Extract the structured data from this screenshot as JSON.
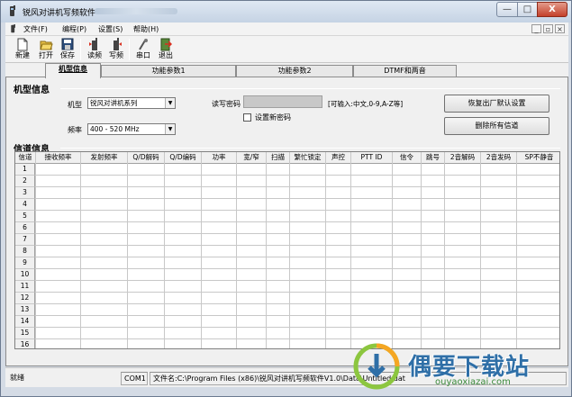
{
  "window": {
    "title": "锐风对讲机写频软件",
    "controls": {
      "minimize": "—",
      "maximize": "□",
      "close": "X"
    }
  },
  "menu": [
    {
      "label": "文件(F)"
    },
    {
      "label": "编程(P)"
    },
    {
      "label": "设置(S)"
    },
    {
      "label": "帮助(H)"
    }
  ],
  "mdi_controls": {
    "minimize": "_",
    "restore": "▫",
    "close": "×"
  },
  "toolbar": {
    "new": "新建",
    "open": "打开",
    "save": "保存",
    "read": "读频",
    "write": "写频",
    "port": "串口",
    "exit": "退出"
  },
  "tabs": [
    {
      "label": "机型信息",
      "active": true
    },
    {
      "label": "功能参数1",
      "active": false
    },
    {
      "label": "功能参数2",
      "active": false
    },
    {
      "label": "DTMF和两音",
      "active": false
    }
  ],
  "model_info": {
    "group_title": "机型信息",
    "model_label": "机型",
    "model_value": "锐风对讲机系列",
    "freq_label": "频率",
    "freq_value": "400 - 520 MHz",
    "pwd_label": "读写密码",
    "pwd_hint": "[可输入:中文,0-9,A-Z等]",
    "new_pwd_label": "设置新密码",
    "restore_button": "恢复出厂默认设置",
    "delete_button": "删除所有信道"
  },
  "channel_info": {
    "group_title": "信道信息",
    "columns": [
      "信道",
      "接收频率",
      "发射频率",
      "Q/D解码",
      "Q/D编码",
      "功率",
      "宽/窄",
      "扫描",
      "繁忙锁定",
      "声控",
      "PTT ID",
      "信令",
      "跳号",
      "2音解码",
      "2音发码",
      "SP不静音"
    ],
    "rows": [
      "1",
      "2",
      "3",
      "4",
      "5",
      "6",
      "7",
      "8",
      "9",
      "10",
      "11",
      "12",
      "13",
      "14",
      "15",
      "16"
    ]
  },
  "status": {
    "state": "就绪",
    "port": "COM1",
    "file": "文件名:C:\\Program Files (x86)\\锐风对讲机写频软件V1.0\\Data\\Untitled.dat"
  },
  "watermark": {
    "text": "偶要下载站",
    "url": "ouyaoxiazai.com"
  },
  "colors": {
    "title_bg": "#dfe8f3",
    "close_red": "#c4402a",
    "panel_bg": "#f0f0f0",
    "watermark_blue": "#2f6fa7",
    "watermark_green": "#3a8a3a"
  }
}
